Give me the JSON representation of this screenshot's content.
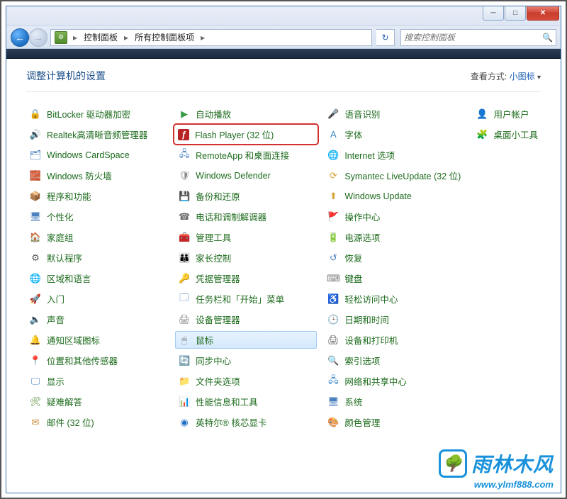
{
  "titlebar": {
    "minimize": "─",
    "maximize": "□",
    "close": "✕"
  },
  "nav": {
    "back": "←",
    "forward": "→"
  },
  "breadcrumb": {
    "part1": "控制面板",
    "part2": "所有控制面板项",
    "sep": "▸"
  },
  "refresh_icon": "↻",
  "search": {
    "placeholder": "搜索控制面板",
    "icon": "🔍"
  },
  "heading": "调整计算机的设置",
  "viewby": {
    "label": "查看方式:",
    "value": "小图标",
    "arrow": "▾"
  },
  "items": [
    {
      "label": "BitLocker 驱动器加密",
      "icon": "🔒",
      "color": "#2b6fb5"
    },
    {
      "label": "Realtek高清晰音频管理器",
      "icon": "🔊",
      "color": "#d46a1e"
    },
    {
      "label": "Windows CardSpace",
      "icon": "🗂",
      "color": "#2b6fb5"
    },
    {
      "label": "Windows 防火墙",
      "icon": "🧱",
      "color": "#c84b28"
    },
    {
      "label": "程序和功能",
      "icon": "📦",
      "color": "#c78a2f"
    },
    {
      "label": "个性化",
      "icon": "🖥",
      "color": "#4a7fbd"
    },
    {
      "label": "家庭组",
      "icon": "🏠",
      "color": "#5fa84a"
    },
    {
      "label": "默认程序",
      "icon": "⚙",
      "color": "#555"
    },
    {
      "label": "区域和语言",
      "icon": "🌐",
      "color": "#3b87c8"
    },
    {
      "label": "入门",
      "icon": "🚀",
      "color": "#2e8fc4"
    },
    {
      "label": "声音",
      "icon": "🔈",
      "color": "#7a7a7a"
    },
    {
      "label": "通知区域图标",
      "icon": "🔔",
      "color": "#5a8f3a"
    },
    {
      "label": "位置和其他传感器",
      "icon": "📍",
      "color": "#5eaa4a"
    },
    {
      "label": "显示",
      "icon": "🖵",
      "color": "#4a7fbd"
    },
    {
      "label": "疑难解答",
      "icon": "🛠",
      "color": "#5a8f3a"
    },
    {
      "label": "邮件 (32 位)",
      "icon": "✉",
      "color": "#c78a2f"
    },
    {
      "label": "自动播放",
      "icon": "▶",
      "color": "#3c9b4a"
    },
    {
      "label": "Flash Player (32 位)",
      "icon": "ƒ",
      "color": "#b82424",
      "highlight": true
    },
    {
      "label": "RemoteApp 和桌面连接",
      "icon": "🖧",
      "color": "#4a7fbd"
    },
    {
      "label": "Windows Defender",
      "icon": "🛡",
      "color": "#888"
    },
    {
      "label": "备份和还原",
      "icon": "💾",
      "color": "#5fa84a"
    },
    {
      "label": "电话和调制解调器",
      "icon": "☎",
      "color": "#6a6a6a"
    },
    {
      "label": "管理工具",
      "icon": "🧰",
      "color": "#4a7fbd"
    },
    {
      "label": "家长控制",
      "icon": "👪",
      "color": "#d9a23a"
    },
    {
      "label": "凭据管理器",
      "icon": "🔑",
      "color": "#c78a2f"
    },
    {
      "label": "任务栏和「开始」菜单",
      "icon": "🗔",
      "color": "#4a7fbd"
    },
    {
      "label": "设备管理器",
      "icon": "🖨",
      "color": "#7a7a7a"
    },
    {
      "label": "鼠标",
      "icon": "🖱",
      "color": "#888",
      "selected": true
    },
    {
      "label": "同步中心",
      "icon": "🔄",
      "color": "#3c9b4a"
    },
    {
      "label": "文件夹选项",
      "icon": "📁",
      "color": "#d9a23a"
    },
    {
      "label": "性能信息和工具",
      "icon": "📊",
      "color": "#4a7fbd"
    },
    {
      "label": "英特尔® 核芯显卡",
      "icon": "◉",
      "color": "#1f6fc4"
    },
    {
      "label": "语音识别",
      "icon": "🎤",
      "color": "#c78a2f"
    },
    {
      "label": "字体",
      "icon": "A",
      "color": "#3b87c8"
    },
    {
      "label": "Internet 选项",
      "icon": "🌐",
      "color": "#3b87c8"
    },
    {
      "label": "Symantec LiveUpdate (32 位)",
      "icon": "⟳",
      "color": "#d9a23a"
    },
    {
      "label": "Windows Update",
      "icon": "⬆",
      "color": "#d9a23a"
    },
    {
      "label": "操作中心",
      "icon": "🚩",
      "color": "#3c9b4a"
    },
    {
      "label": "电源选项",
      "icon": "🔋",
      "color": "#3c9b4a"
    },
    {
      "label": "恢复",
      "icon": "↺",
      "color": "#4a7fbd"
    },
    {
      "label": "键盘",
      "icon": "⌨",
      "color": "#7a7a7a"
    },
    {
      "label": "轻松访问中心",
      "icon": "♿",
      "color": "#3b87c8"
    },
    {
      "label": "日期和时间",
      "icon": "🕒",
      "color": "#4a7fbd"
    },
    {
      "label": "设备和打印机",
      "icon": "🖨",
      "color": "#5a5a5a"
    },
    {
      "label": "索引选项",
      "icon": "🔍",
      "color": "#7a7a7a"
    },
    {
      "label": "网络和共享中心",
      "icon": "🖧",
      "color": "#3b87c8"
    },
    {
      "label": "系统",
      "icon": "🖥",
      "color": "#4a7fbd"
    },
    {
      "label": "颜色管理",
      "icon": "🎨",
      "color": "#5fa84a"
    },
    {
      "label": "用户帐户",
      "icon": "👤",
      "color": "#5fa84a"
    },
    {
      "label": "桌面小工具",
      "icon": "🧩",
      "color": "#4a7fbd"
    }
  ],
  "watermark": {
    "text": "雨林木风",
    "url": "www.ylmf888.com",
    "logo_glyph": "🌳"
  }
}
